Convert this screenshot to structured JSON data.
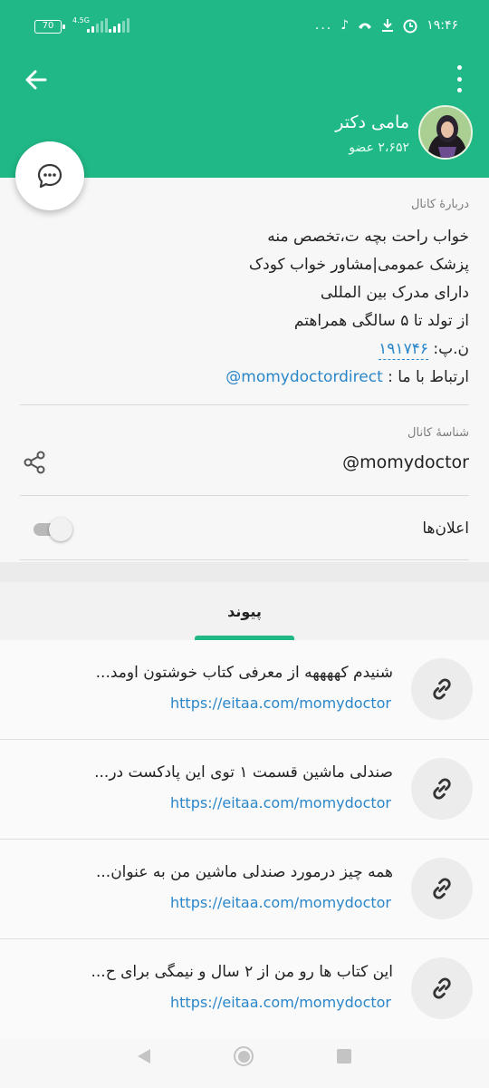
{
  "status_bar": {
    "battery": "70",
    "network": "4.5G",
    "time": "۱۹:۴۶",
    "dots": "..."
  },
  "header": {
    "channel_name": "مامی دکتر",
    "members": "۲،۶۵۲ عضو"
  },
  "about": {
    "label": "دربارهٔ کانال",
    "lines": [
      "خواب راحت بچه ت،تخصص منه",
      "پزشک عمومی|مشاور خواب کودک",
      "دارای مدرک بین المللی",
      "از تولد تا ۵ سالگی همراهتم"
    ],
    "np_prefix": "ن.پ: ",
    "np_number": "۱۹۱۷۴۶",
    "contact_prefix": "ارتباط با ما : ",
    "contact_link": "@momydoctordirect"
  },
  "channel_id": {
    "label": "شناسهٔ کانال",
    "username": "@momydoctor"
  },
  "notifications": {
    "label": "اعلان‌ها",
    "enabled": false
  },
  "tabs": {
    "active": "پیوند"
  },
  "links": [
    {
      "title": "شنیدم کههههه از معرفی کتاب خوشتون اومد...",
      "url": "https://eitaa.com/momydoctor"
    },
    {
      "title": "صندلی ماشین قسمت ۱  توی این پادکست در...",
      "url": "https://eitaa.com/momydoctor"
    },
    {
      "title": "همه چیز درمورد صندلی ماشین   من به عنوان...",
      "url": "https://eitaa.com/momydoctor"
    },
    {
      "title": "این کتاب ها رو من از ۲ سال و نیمگی برای ح...",
      "url": "https://eitaa.com/momydoctor"
    }
  ],
  "colors": {
    "primary": "#20b887",
    "link": "#2a86c9"
  },
  "icons": [
    "back-arrow-icon",
    "more-vert-icon",
    "chat-bubble-icon",
    "share-icon",
    "link-icon"
  ]
}
